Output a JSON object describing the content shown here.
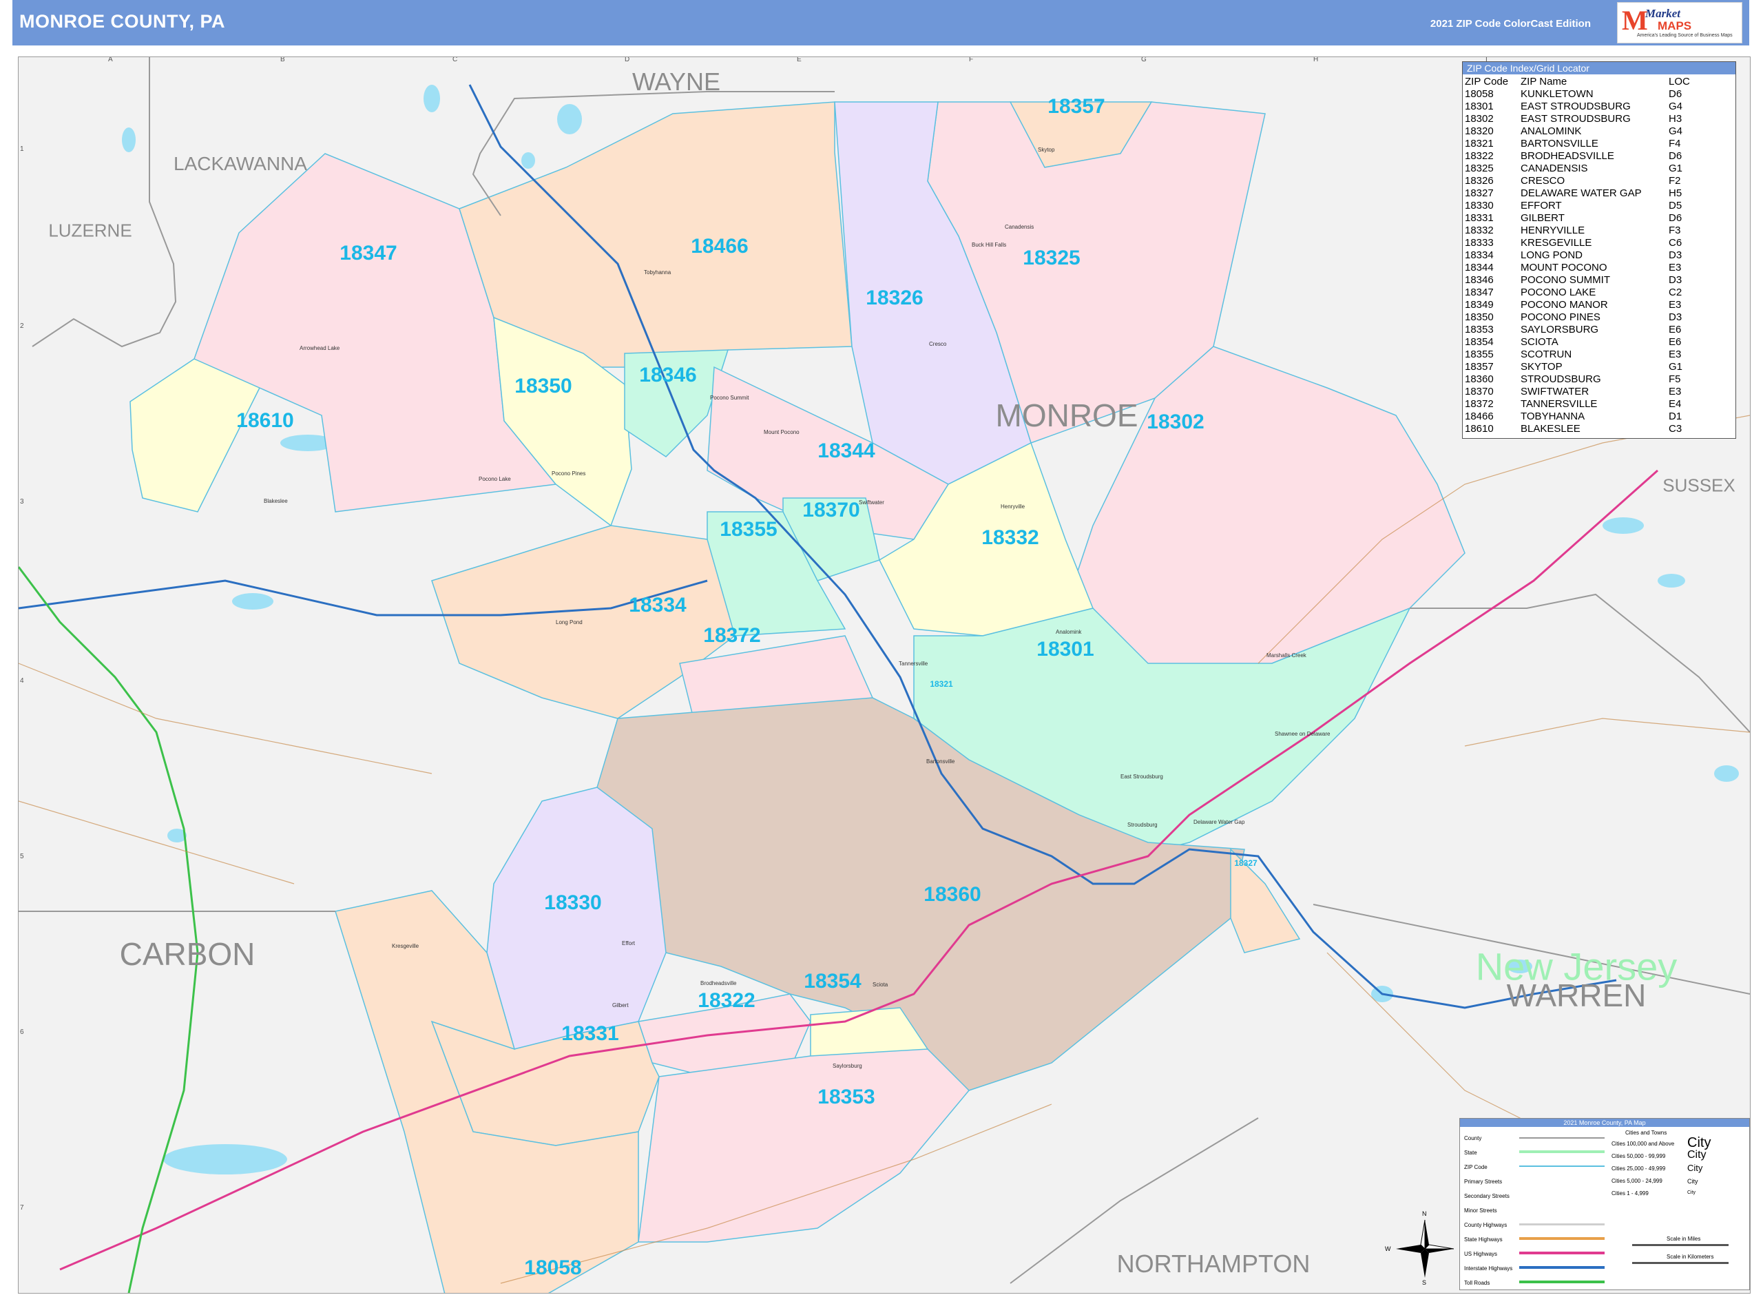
{
  "header": {
    "title": "MONROE COUNTY, PA",
    "edition": "2021 ZIP Code ColorCast Edition",
    "logo": {
      "brand_line1": "Market",
      "brand_line2": "MAPS",
      "tagline": "America's Leading Source of Business Maps"
    }
  },
  "grid": {
    "columns": [
      "A",
      "B",
      "C",
      "D",
      "E",
      "F",
      "G",
      "H",
      "I"
    ],
    "rows": [
      "1",
      "2",
      "3",
      "4",
      "5",
      "6",
      "7"
    ]
  },
  "counties": {
    "wayne": "WAYNE",
    "lackawanna": "LACKAWANNA",
    "luzerne": "LUZERNE",
    "monroe": "MONROE",
    "sussex": "SUSSEX",
    "carbon": "CARBON",
    "warren": "WARREN",
    "northampton": "NORTHAMPTON",
    "state_nj": "New Jersey"
  },
  "zip_labels": {
    "z18357": "18357",
    "z18347": "18347",
    "z18466": "18466",
    "z18325": "18325",
    "z18326": "18326",
    "z18346": "18346",
    "z18350": "18350",
    "z18610": "18610",
    "z18302": "18302",
    "z18344": "18344",
    "z18370": "18370",
    "z18355": "18355",
    "z18332": "18332",
    "z18334": "18334",
    "z18372": "18372",
    "z18301": "18301",
    "z18360": "18360",
    "z18330": "18330",
    "z18354": "18354",
    "z18322": "18322",
    "z18331": "18331",
    "z18353": "18353",
    "z18058": "18058",
    "z18321": "18321",
    "z18327": "18327"
  },
  "places": {
    "p1": "Pocono Summit",
    "p2": "Tobyhanna",
    "p3": "Mount Pocono",
    "p4": "Stroudsburg",
    "p5": "East Stroudsburg",
    "p6": "Tannersville",
    "p7": "Brodheadsville",
    "p8": "Effort",
    "p9": "Kresgeville",
    "p10": "Saylorsburg",
    "p11": "Blakeslee",
    "p12": "Long Pond",
    "p13": "Delaware Water Gap",
    "p14": "Marshalls Creek",
    "p15": "Buck Hill Falls",
    "p16": "Canadensis",
    "p17": "Skytop",
    "p18": "Cresco",
    "p19": "Henryville",
    "p20": "Swiftwater",
    "p21": "Bartonsville",
    "p22": "Sciota",
    "p23": "Gilbert",
    "p24": "Shawnee on Delaware",
    "p25": "Analomink",
    "p26": "Pocono Pines",
    "p27": "Pocono Lake",
    "p28": "Arrowhead Lake",
    "p29": "Brodheadsville"
  },
  "zip_index": {
    "title": "ZIP Code Index/Grid Locator",
    "headers": [
      "ZIP Code",
      "ZIP Name",
      "LOC"
    ],
    "rows": [
      [
        "18058",
        "KUNKLETOWN",
        "D6"
      ],
      [
        "18301",
        "EAST STROUDSBURG",
        "G4"
      ],
      [
        "18302",
        "EAST STROUDSBURG",
        "H3"
      ],
      [
        "18320",
        "ANALOMINK",
        "G4"
      ],
      [
        "18321",
        "BARTONSVILLE",
        "F4"
      ],
      [
        "18322",
        "BRODHEADSVILLE",
        "D6"
      ],
      [
        "18325",
        "CANADENSIS",
        "G1"
      ],
      [
        "18326",
        "CRESCO",
        "F2"
      ],
      [
        "18327",
        "DELAWARE WATER GAP",
        "H5"
      ],
      [
        "18330",
        "EFFORT",
        "D5"
      ],
      [
        "18331",
        "GILBERT",
        "D6"
      ],
      [
        "18332",
        "HENRYVILLE",
        "F3"
      ],
      [
        "18333",
        "KRESGEVILLE",
        "C6"
      ],
      [
        "18334",
        "LONG POND",
        "D3"
      ],
      [
        "18344",
        "MOUNT POCONO",
        "E3"
      ],
      [
        "18346",
        "POCONO SUMMIT",
        "D3"
      ],
      [
        "18347",
        "POCONO LAKE",
        "C2"
      ],
      [
        "18349",
        "POCONO MANOR",
        "E3"
      ],
      [
        "18350",
        "POCONO PINES",
        "D3"
      ],
      [
        "18353",
        "SAYLORSBURG",
        "E6"
      ],
      [
        "18354",
        "SCIOTA",
        "E6"
      ],
      [
        "18355",
        "SCOTRUN",
        "E3"
      ],
      [
        "18357",
        "SKYTOP",
        "G1"
      ],
      [
        "18360",
        "STROUDSBURG",
        "F5"
      ],
      [
        "18370",
        "SWIFTWATER",
        "E3"
      ],
      [
        "18372",
        "TANNERSVILLE",
        "E4"
      ],
      [
        "18466",
        "TOBYHANNA",
        "D1"
      ],
      [
        "18610",
        "BLAKESLEE",
        "C3"
      ]
    ]
  },
  "legend": {
    "title": "2021 Monroe County, PA Map",
    "items": [
      "County",
      "State",
      "ZIP Code",
      "Primary Streets",
      "Secondary Streets",
      "Minor Streets",
      "County Highways",
      "State Highways",
      "US Highways",
      "Interstate Highways",
      "Toll Roads"
    ],
    "cities_title": "Cities and Towns",
    "city_sizes": [
      "Cities 100,000 and Above",
      "Cities 50,000 - 99,999",
      "Cities 25,000 - 49,999",
      "Cities 5,000 - 24,999",
      "Cities 1 - 4,999"
    ],
    "city_samples": [
      "City",
      "City",
      "City",
      "City",
      "City"
    ],
    "scale_miles": "Scale in Miles",
    "scale_km": "Scale in Kilometers"
  },
  "compass": {
    "n": "N",
    "s": "S",
    "e": "E",
    "w": "W"
  },
  "colors": {
    "header": "#6f97d8",
    "zip_label": "#1ab7e6",
    "pink": "#fde0e6",
    "peach": "#fde2cc",
    "lavender": "#e9e0fb",
    "yellow": "#fffed8",
    "mint": "#c8f9e4",
    "tan": "#e0ccc0",
    "water": "#9fe0f5",
    "background": "#f2f2f2"
  }
}
